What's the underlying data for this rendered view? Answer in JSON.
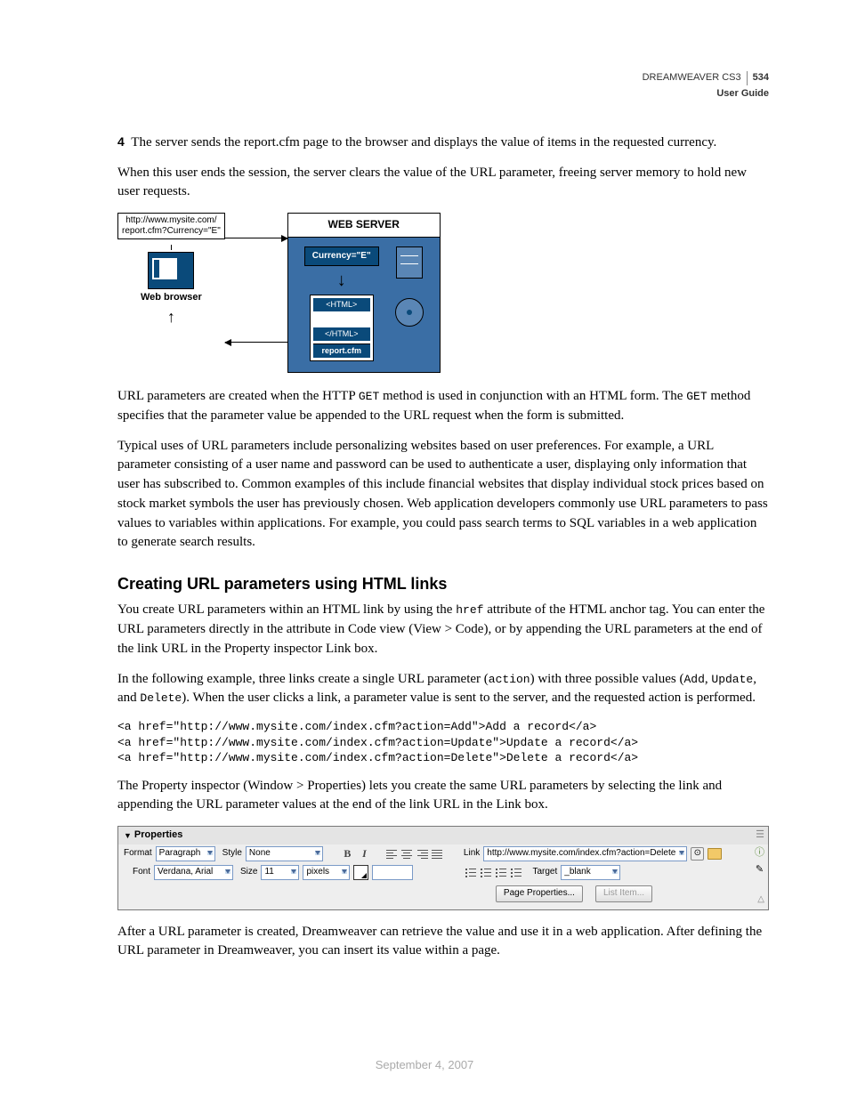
{
  "header": {
    "product": "DREAMWEAVER CS3",
    "page_num": "534",
    "subtitle": "User Guide"
  },
  "step_num": "4",
  "p1a": "The server sends the report.cfm page to the browser and displays the value of items in the requested currency.",
  "p1b": "When this user ends the session, the server clears the value of the URL parameter, freeing server memory to hold new user requests.",
  "diagram": {
    "url_line1": "http://www.mysite.com/",
    "url_line2": "report.cfm?Currency=\"E\"",
    "web_browser": "Web browser",
    "web_server": "WEB SERVER",
    "currency": "Currency=\"E\"",
    "html_open": "<HTML>",
    "html_close": "</HTML>",
    "report": "report.cfm"
  },
  "p2a": "URL parameters are created when the HTTP ",
  "p2_code1": "GET",
  "p2b": " method is used in conjunction with an HTML form. The ",
  "p2_code2": "GET",
  "p2c": " method specifies that the parameter value be appended to the URL request when the form is submitted.",
  "p3": "Typical uses of URL parameters include personalizing websites based on user preferences. For example, a URL parameter consisting of a user name and password can be used to authenticate a user, displaying only information that user has subscribed to. Common examples of this include financial websites that display individual stock prices based on stock market symbols the user has previously chosen. Web application developers commonly use URL parameters to pass values to variables within applications. For example, you could pass search terms to SQL variables in a web application to generate search results.",
  "h2": "Creating URL parameters using HTML links",
  "p4a": "You create URL parameters within an HTML link by using the ",
  "p4_code": "href",
  "p4b": " attribute of the HTML anchor tag. You can enter the URL parameters directly in the attribute in Code view (View > Code), or by appending the URL parameters at the end of the link URL in the Property inspector Link box.",
  "p5a": "In the following example, three links create a single URL parameter (",
  "p5_c1": "action",
  "p5b": ") with three possible values (",
  "p5_c2": "Add",
  "p5c": ", ",
  "p5_c3": "Update",
  "p5d": ", and ",
  "p5_c4": "Delete",
  "p5e": "). When the user clicks a link, a parameter value is sent to the server, and the requested action is performed.",
  "code1": "<a href=\"http://www.mysite.com/index.cfm?action=Add\">Add a record</a>",
  "code2": "<a href=\"http://www.mysite.com/index.cfm?action=Update\">Update a record</a>",
  "code3": "<a href=\"http://www.mysite.com/index.cfm?action=Delete\">Delete a record</a>",
  "p6": "The Property inspector (Window > Properties) lets you create the same URL parameters by selecting the link and appending the URL parameter values at the end of the link URL in the Link box.",
  "props": {
    "title": "Properties",
    "format_lbl": "Format",
    "format_val": "Paragraph",
    "style_lbl": "Style",
    "style_val": "None",
    "link_lbl": "Link",
    "link_val": "http://www.mysite.com/index.cfm?action=Delete",
    "font_lbl": "Font",
    "font_val": "Verdana, Arial",
    "size_lbl": "Size",
    "size_val": "11",
    "size_unit": "pixels",
    "target_lbl": "Target",
    "target_val": "_blank",
    "page_props_btn": "Page Properties...",
    "list_item_btn": "List Item..."
  },
  "p7": "After a URL parameter is created, Dreamweaver can retrieve the value and use it in a web application. After defining the URL parameter in Dreamweaver, you can insert its value within a page.",
  "footer_date": "September 4, 2007"
}
